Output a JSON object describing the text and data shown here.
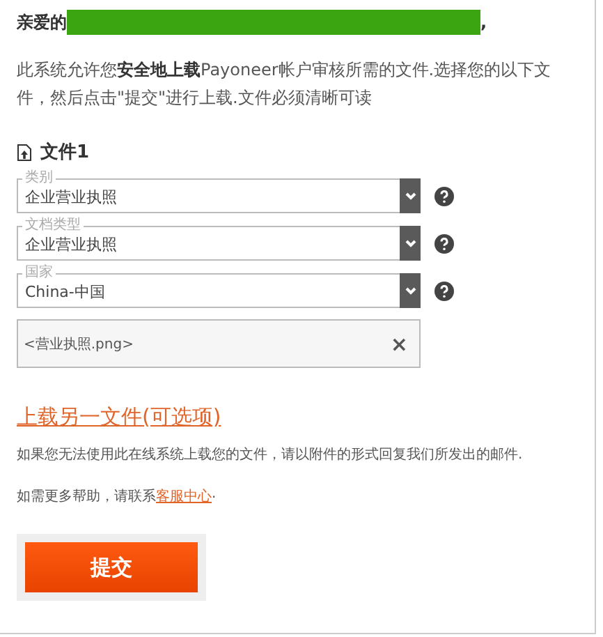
{
  "greeting": {
    "salutation": "亲爱的",
    "punctuation": ","
  },
  "intro": "此系统允许您**安全地上载**Payoneer帐户审核所需的文件.选择您的以下文件，然后点击\"提交\"进行上载.文件必须清晰可读",
  "file_section": {
    "title": "文件1",
    "selects": [
      {
        "label": "类别",
        "value": "企业营业执照"
      },
      {
        "label": "文档类型",
        "value": "企业营业执照"
      },
      {
        "label": "国家",
        "value": "China-中国"
      }
    ],
    "file_name": "<营业执照.png>",
    "remove": "×"
  },
  "add_link": "上载另一文件(可选项)",
  "note": "如果您无法使用此在线系统上载您的文件，请以附件的形式回复我们所发出的邮件.",
  "help": {
    "text": "如需更多帮助，请联系",
    "link": "客服中心",
    "end": "."
  },
  "submit": "提交"
}
